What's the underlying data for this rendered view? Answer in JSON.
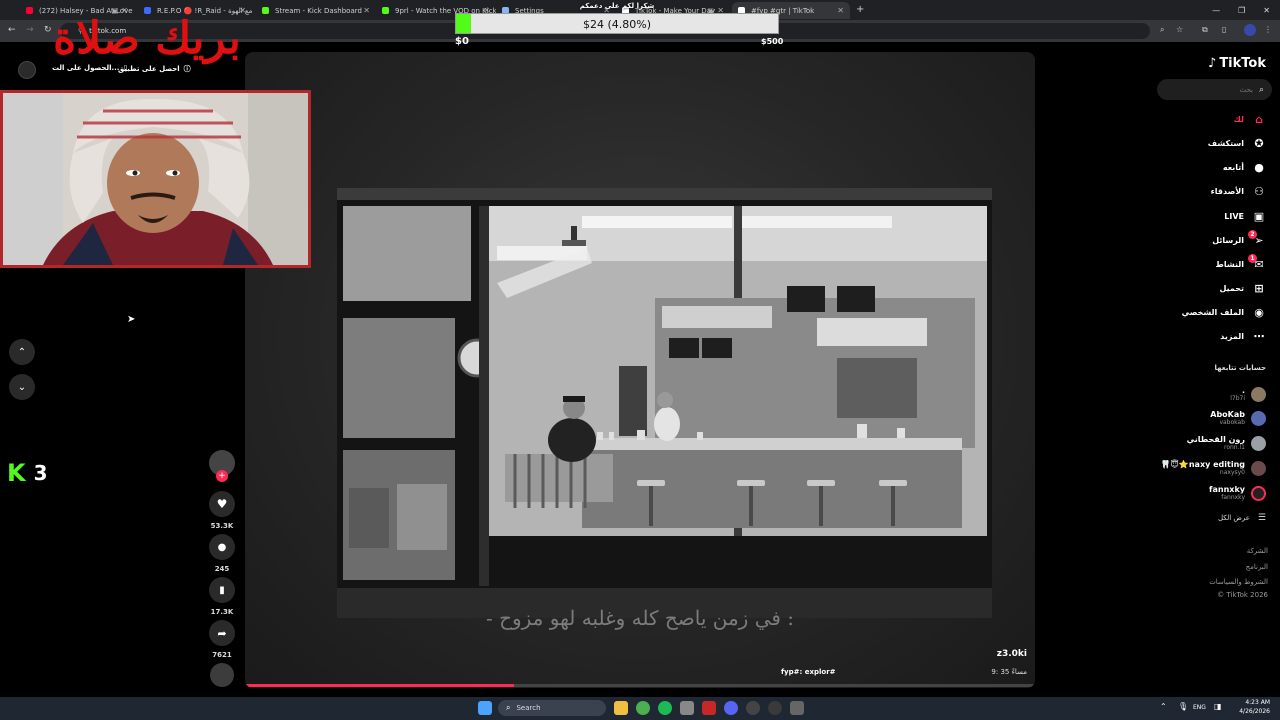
{
  "browser": {
    "tabs": [
      {
        "title": "(272) Halsey - Bad At Love",
        "color": "#ff0033"
      },
      {
        "title": "R.E.P.O 🔴 !R_Raid - مع الهوة - Ret",
        "color": "#3a6bff"
      },
      {
        "title": "Stream - Kick Dashboard",
        "color": "#53fc18"
      },
      {
        "title": "9prl - Watch the VOD on Kick",
        "color": "#53fc18"
      },
      {
        "title": "Settings",
        "color": "#8ab4f8"
      },
      {
        "title": "TikTok - Make Your Day",
        "color": "#ffffff"
      },
      {
        "title": "#fyp #qtr | TikTok",
        "color": "#ffffff"
      }
    ],
    "new_tab": "+",
    "url": "tiktok.com"
  },
  "overlay": {
    "title_text": "بريك صلاة",
    "banner_text": "شكرا لكم على دعمكم",
    "goal_amount": "$24 (4.80%)",
    "goal_min": "$0",
    "goal_max": "$500",
    "goal_progress": 0.048,
    "kick_count": "3",
    "kick_letter": "K"
  },
  "top_bar": {
    "get_app": "احصل على تطبيق",
    "get_coins": "الحصول على الت..."
  },
  "sidebar": {
    "brand": "TikTok",
    "search_placeholder": "بحث",
    "nav": [
      {
        "label": "لك",
        "icon": "home-icon",
        "active": true
      },
      {
        "label": "استكشف",
        "icon": "compass-icon"
      },
      {
        "label": "أتابعه",
        "icon": "following-avatar-icon"
      },
      {
        "label": "الأصدقاء",
        "icon": "friends-icon"
      },
      {
        "label": "LIVE",
        "icon": "live-icon"
      },
      {
        "label": "الرسائل",
        "icon": "send-icon",
        "badge": "2"
      },
      {
        "label": "النشاط",
        "icon": "inbox-icon",
        "badge": "1"
      },
      {
        "label": "تحميل",
        "icon": "upload-icon"
      },
      {
        "label": "الملف الشخصي",
        "icon": "profile-icon"
      },
      {
        "label": "المزيد",
        "icon": "more-icon"
      }
    ],
    "following_header": "حسابات تتابعها",
    "following": [
      {
        "name": ".",
        "user": "l7b7i"
      },
      {
        "name": "AboKab",
        "user": "vabokab"
      },
      {
        "name": "رون القحطاني",
        "user": "ronn.l1"
      },
      {
        "name": "🦷😇⭐naxy editing",
        "user": "naxysy0"
      },
      {
        "name": "fannxky",
        "user": "fannxky"
      }
    ],
    "see_all": "عرض الكل",
    "footer": [
      "الشركة",
      "البرنامج",
      "الشروط والسياسات",
      "© TikTok 2026"
    ]
  },
  "video": {
    "author": "z3.0ki",
    "caption": "fyp#: explor#",
    "time": "9: 35 مساءً",
    "subtitle": "- في زمن ياصح كله وغلبه لهو مزوح :",
    "progress": 0.34
  },
  "actions": {
    "likes": "53.3K",
    "comments": "245",
    "saves": "17.3K",
    "shares": "7621"
  },
  "taskbar": {
    "search": "Search",
    "lang": "ENG",
    "time": "4:23 AM",
    "date": "4/26/2026"
  }
}
